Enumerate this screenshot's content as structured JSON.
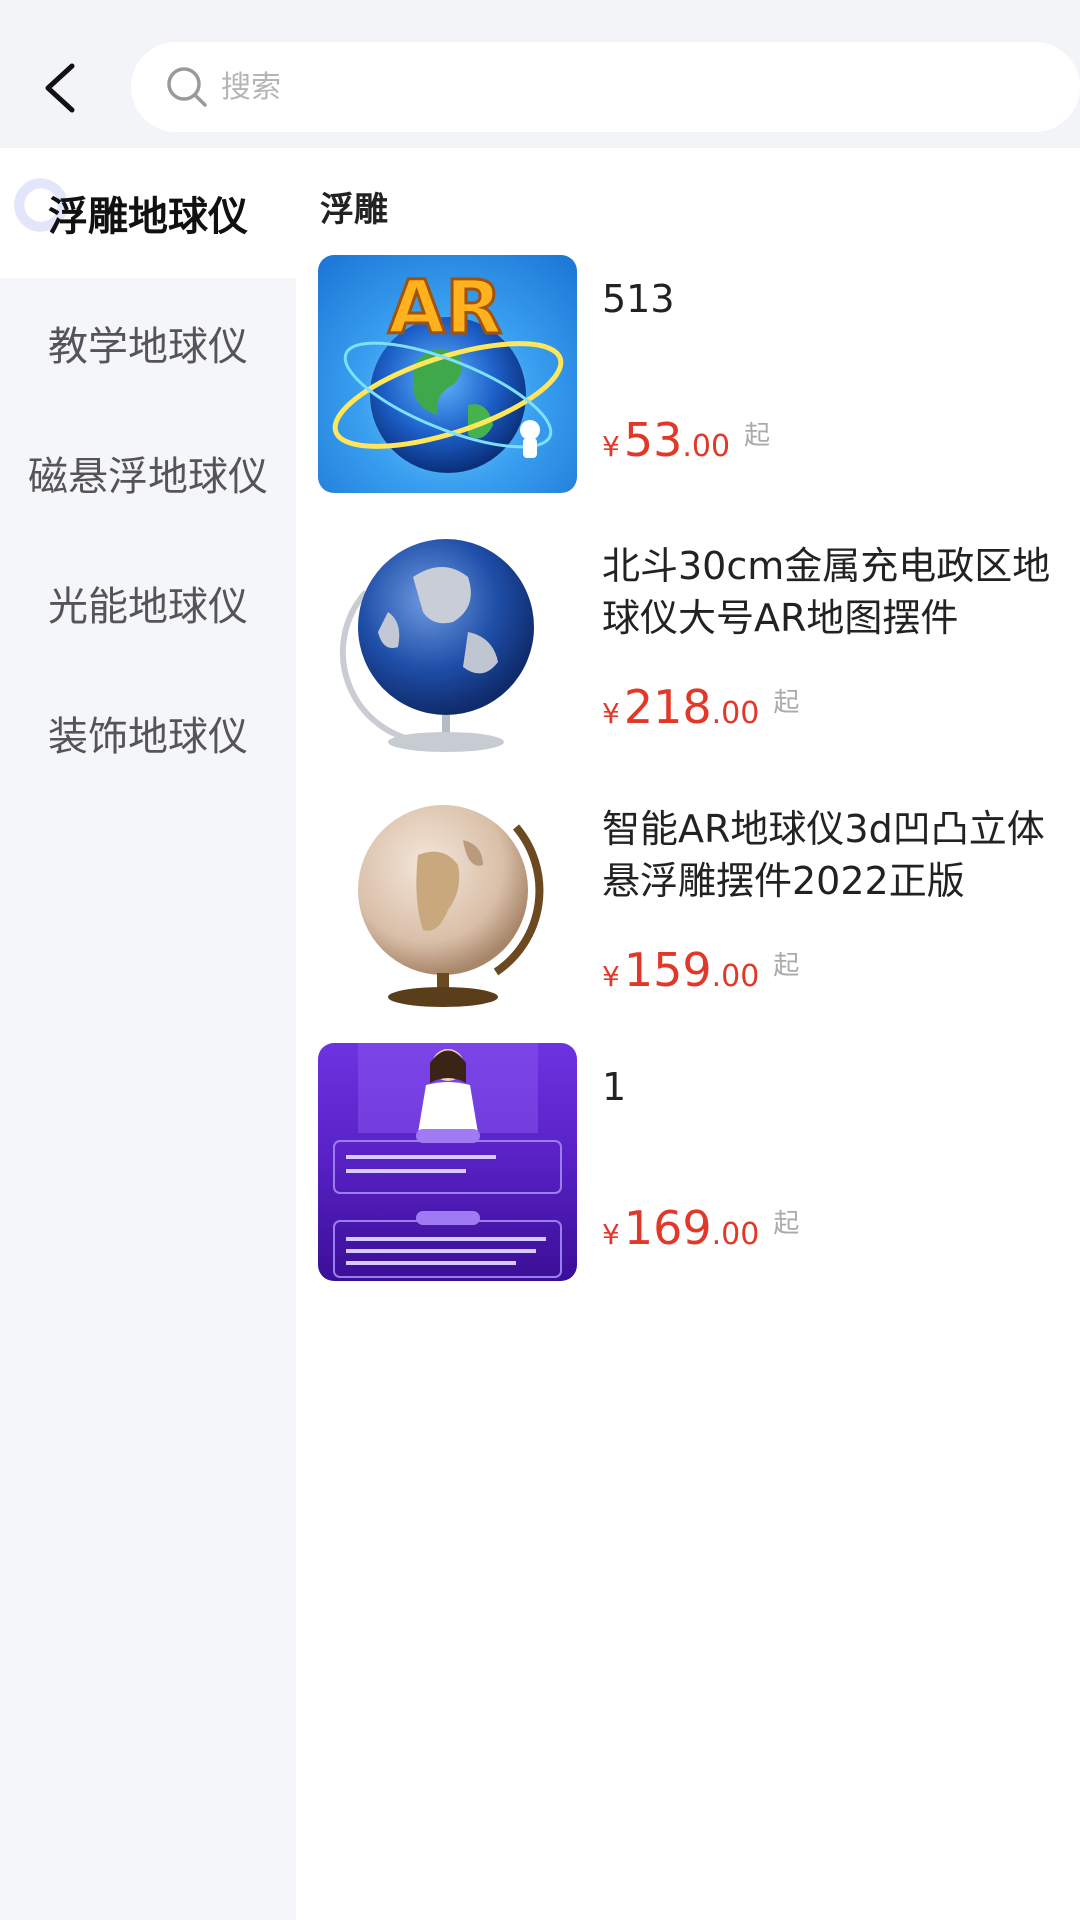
{
  "header": {
    "back_icon": "back-arrow-icon",
    "search": {
      "placeholder": "搜索",
      "value": "",
      "icon": "search-icon"
    }
  },
  "sidebar": {
    "items": [
      {
        "label": "浮雕地球仪",
        "active": true
      },
      {
        "label": "教学地球仪",
        "active": false
      },
      {
        "label": "磁悬浮地球仪",
        "active": false
      },
      {
        "label": "光能地球仪",
        "active": false
      },
      {
        "label": "装饰地球仪",
        "active": false
      }
    ]
  },
  "main": {
    "section_title": "浮雕",
    "products": [
      {
        "name": "513",
        "currency": "¥",
        "price_int": "53",
        "price_dec": ".00",
        "suffix": "起",
        "image": "ar-globe-logo"
      },
      {
        "name": "北斗30cm金属充电政区地球仪大号AR地图摆件",
        "currency": "¥",
        "price_int": "218",
        "price_dec": ".00",
        "suffix": "起",
        "image": "blue-metal-globe"
      },
      {
        "name": "智能AR地球仪3d凹凸立体悬浮雕摆件2022正版",
        "currency": "¥",
        "price_int": "159",
        "price_dec": ".00",
        "suffix": "起",
        "image": "antique-globe"
      },
      {
        "name": "1",
        "currency": "¥",
        "price_int": "169",
        "price_dec": ".00",
        "suffix": "起",
        "image": "purple-event-poster"
      }
    ]
  },
  "colors": {
    "price": "#e2382a",
    "active_bg": "#ffffff",
    "sidebar_bg": "#f5f6fa"
  }
}
